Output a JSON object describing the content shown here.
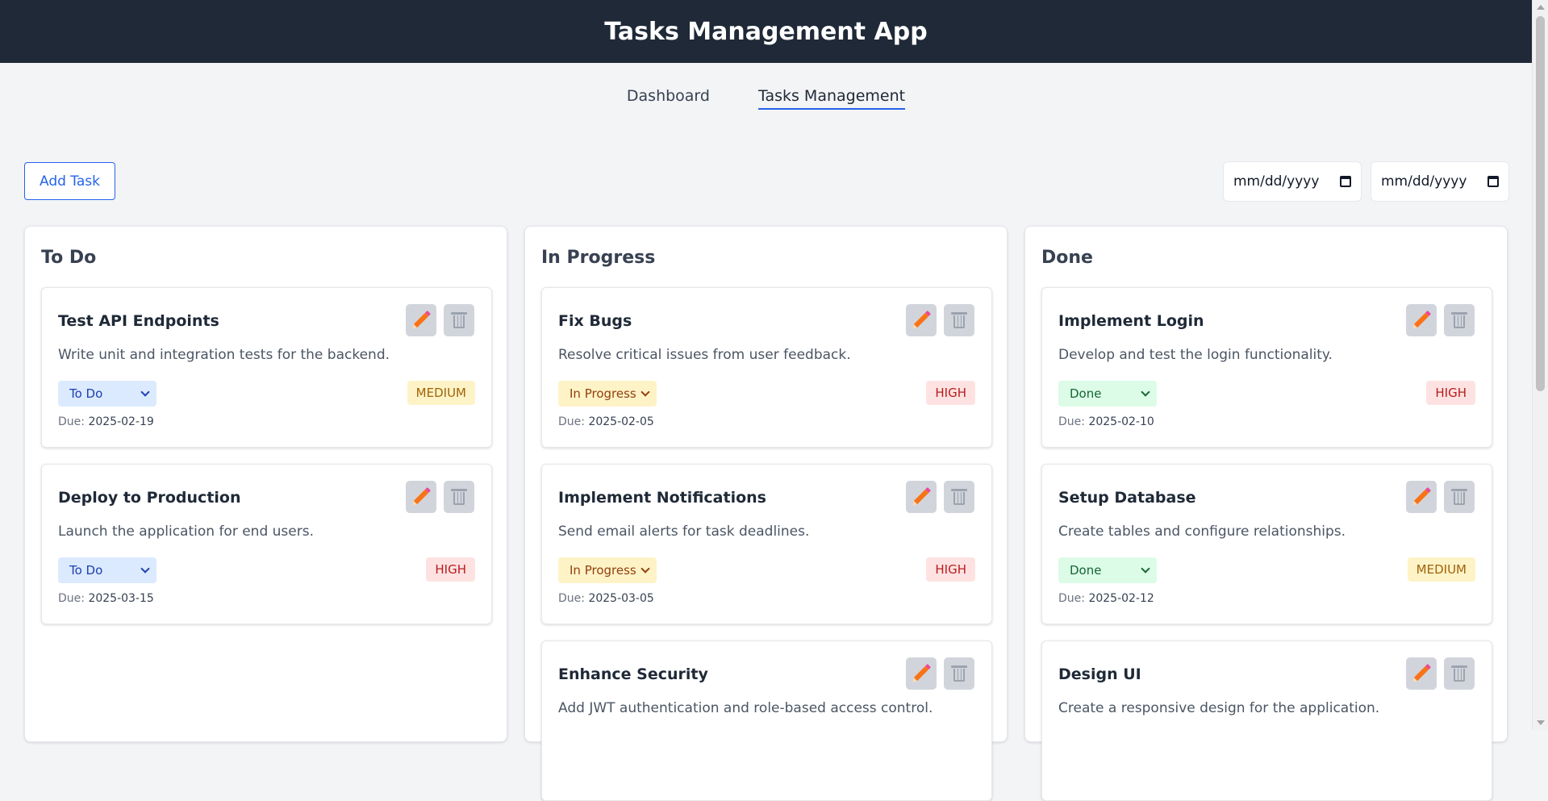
{
  "app": {
    "title": "Tasks Management App"
  },
  "nav": {
    "items": [
      "Dashboard",
      "Tasks Management"
    ],
    "active": "Tasks Management"
  },
  "toolbar": {
    "add_task_label": "Add Task",
    "start_date_placeholder": "mm/dd/yyyy",
    "end_date_placeholder": "mm/dd/yyyy"
  },
  "columns": [
    {
      "title": "To Do",
      "tasks": [
        {
          "title": "Test API Endpoints",
          "description": "Write unit and integration tests for the backend.",
          "status": "To Do",
          "priority": "MEDIUM",
          "due_label": "Due:",
          "due": "2025-02-19"
        },
        {
          "title": "Deploy to Production",
          "description": "Launch the application for end users.",
          "status": "To Do",
          "priority": "HIGH",
          "due_label": "Due:",
          "due": "2025-03-15"
        }
      ]
    },
    {
      "title": "In Progress",
      "tasks": [
        {
          "title": "Fix Bugs",
          "description": "Resolve critical issues from user feedback.",
          "status": "In Progress",
          "priority": "HIGH",
          "due_label": "Due:",
          "due": "2025-02-05"
        },
        {
          "title": "Implement Notifications",
          "description": "Send email alerts for task deadlines.",
          "status": "In Progress",
          "priority": "HIGH",
          "due_label": "Due:",
          "due": "2025-03-05"
        },
        {
          "title": "Enhance Security",
          "description": "Add JWT authentication and role-based access control."
        }
      ]
    },
    {
      "title": "Done",
      "tasks": [
        {
          "title": "Implement Login",
          "description": "Develop and test the login functionality.",
          "status": "Done",
          "priority": "HIGH",
          "due_label": "Due:",
          "due": "2025-02-10"
        },
        {
          "title": "Setup Database",
          "description": "Create tables and configure relationships.",
          "status": "Done",
          "priority": "MEDIUM",
          "due_label": "Due:",
          "due": "2025-02-12"
        },
        {
          "title": "Design UI",
          "description": "Create a responsive design for the application."
        }
      ]
    }
  ],
  "icons": {
    "edit": "pencil-icon",
    "delete": "trash-icon",
    "calendar": "calendar-icon",
    "dropdown": "chevron-down-icon"
  },
  "colors": {
    "header_bg": "#1f2937",
    "accent": "#2563eb",
    "background": "#f3f4f6"
  }
}
